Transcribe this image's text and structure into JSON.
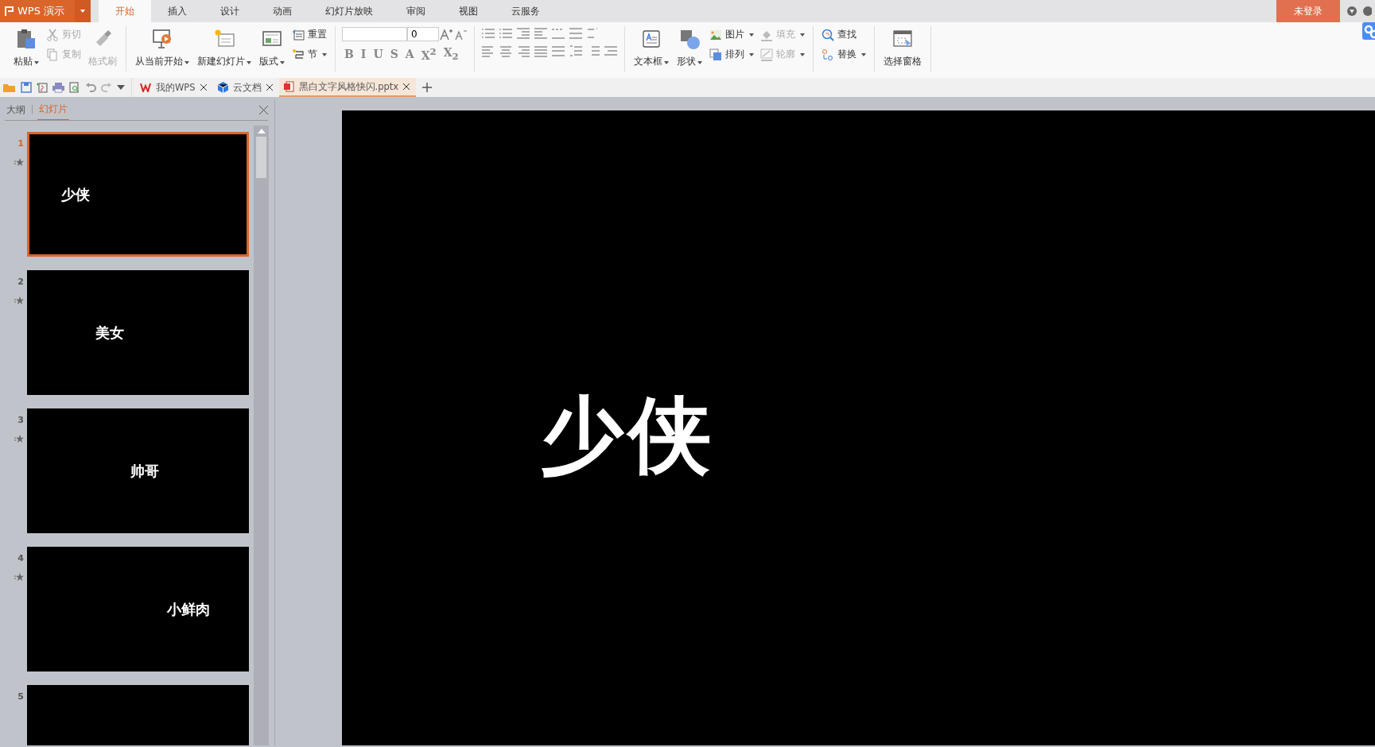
{
  "app": {
    "logo": "WPS 演示",
    "login": "未登录"
  },
  "tabs": [
    {
      "label": "开始",
      "selected": true
    },
    {
      "label": "插入",
      "selected": false
    },
    {
      "label": "设计",
      "selected": false
    },
    {
      "label": "动画",
      "selected": false
    },
    {
      "label": "幻灯片放映",
      "selected": false
    },
    {
      "label": "审阅",
      "selected": false
    },
    {
      "label": "视图",
      "selected": false
    },
    {
      "label": "云服务",
      "selected": false
    }
  ],
  "ribbon": {
    "clipboard": {
      "paste": {
        "label": "粘贴",
        "disabled": false
      },
      "cut": {
        "label": "剪切",
        "disabled": true
      },
      "copy": {
        "label": "复制",
        "disabled": true
      },
      "painter": {
        "label": "格式刷",
        "disabled": true
      }
    },
    "slides": {
      "play": {
        "label": "从当前开始"
      },
      "new_slide": {
        "label": "新建幻灯片"
      },
      "layout": {
        "label": "版式"
      },
      "reset": {
        "label": "重置"
      },
      "section": {
        "label": "节"
      }
    },
    "font": {
      "size": "0",
      "buttons": [
        "B",
        "I",
        "U",
        "S",
        "A",
        "X$^{2}$",
        "X$_{2}$"
      ]
    },
    "drawing": {
      "textbox": {
        "label": "文本框"
      },
      "shape": {
        "label": "形状"
      },
      "picture": {
        "label": "图片",
        "disabled": false
      },
      "arrange": {
        "label": "排列",
        "disabled": false
      },
      "fill": {
        "label": "填充",
        "disabled": true
      },
      "outline": {
        "label": "轮廓",
        "disabled": true
      }
    },
    "edit": {
      "find": {
        "label": "查找"
      },
      "replace": {
        "label": "替换"
      }
    },
    "select_pane": {
      "label": "选择窗格"
    }
  },
  "doc_tabs": [
    {
      "label": "我的WPS",
      "selected": false
    },
    {
      "label": "云文档",
      "selected": false
    },
    {
      "label": "黑白文字风格快闪.pptx",
      "selected": true
    }
  ],
  "panel": {
    "tabs": [
      {
        "label": "大纲",
        "selected": false
      },
      {
        "label": "幻灯片",
        "selected": true
      }
    ],
    "slides": [
      {
        "number": "1",
        "text": "少侠",
        "selected": true,
        "animated": true
      },
      {
        "number": "2",
        "text": "美女",
        "selected": false,
        "animated": true
      },
      {
        "number": "3",
        "text": "帅哥",
        "selected": false,
        "animated": true
      },
      {
        "number": "4",
        "text": "小鲜肉",
        "selected": false,
        "animated": true
      },
      {
        "number": "5",
        "selected": false,
        "animated": false
      }
    ]
  },
  "canvas": {
    "text": "少侠"
  }
}
